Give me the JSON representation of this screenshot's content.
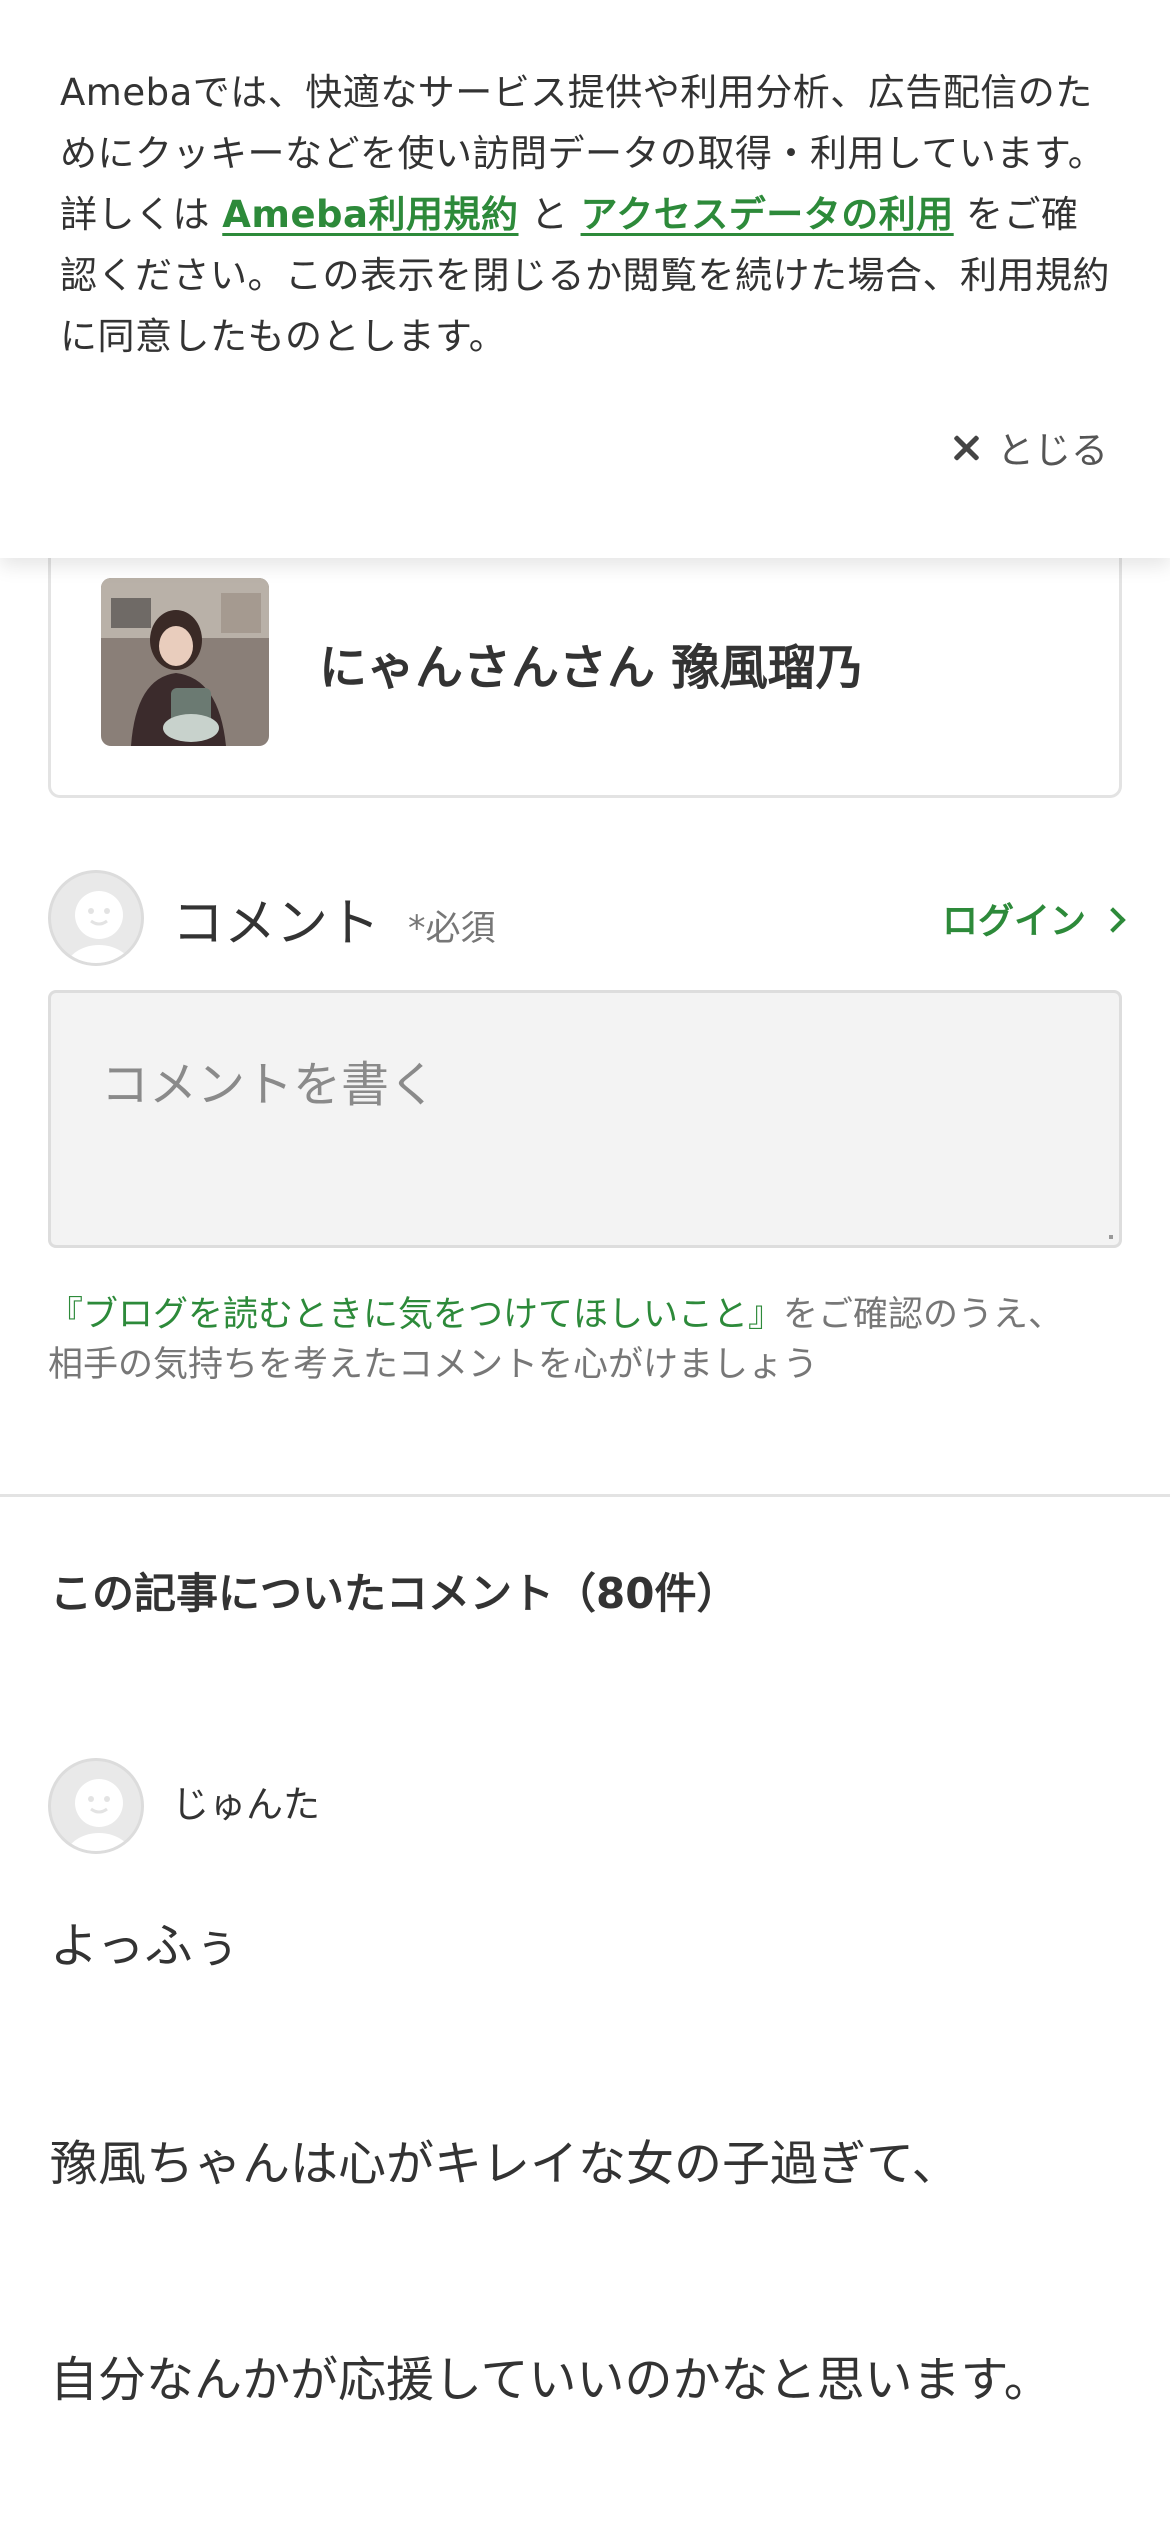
{
  "cookie_banner": {
    "text_before": "Amebaでは、快適なサービス提供や利用分析、広告配信のためにクッキーなどを使い訪問データの取得・利用しています。詳しくは ",
    "terms_link": "Ameba利用規約",
    "and_text": " と ",
    "access_link": "アクセスデータの利用",
    "text_after": " をご確認ください。この表示を閉じるか閲覧を続けた場合、利用規約に同意したものとします。",
    "close_label": "とじる"
  },
  "blogger": {
    "name": "にゃんさんさん 豫風瑠乃"
  },
  "comment_form": {
    "title": "コメント",
    "required": "*必須",
    "login_label": "ログイン",
    "placeholder": "コメントを書く",
    "guide_link": "『ブログを読むときに気をつけてほしいこと』",
    "guide_text_1": "をご確認のうえ、",
    "guide_text_2": "相手の気持ちを考えたコメントを心がけましょう"
  },
  "comments_section": {
    "heading": "この記事についたコメント（80件）",
    "comments": [
      {
        "author": "じゅんた",
        "lines": [
          "よっふぅ",
          "豫風ちゃんは心がキレイな女の子過ぎて、",
          "自分なんかが応援していいのかなと思います。"
        ]
      }
    ]
  },
  "colors": {
    "accent": "#2d8a3a",
    "text": "#333333",
    "muted": "#777777"
  },
  "icons": [
    "close-icon",
    "chevron-right-icon",
    "default-avatar-icon"
  ]
}
